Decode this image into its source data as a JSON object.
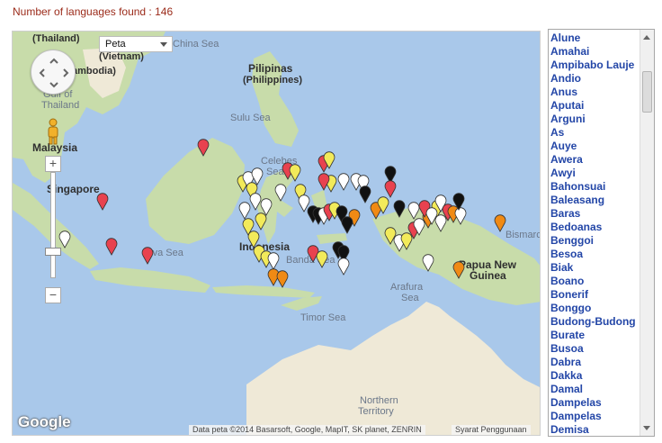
{
  "header": {
    "count_text": "Number of languages found : 146"
  },
  "map": {
    "type_select": "Peta",
    "labels": {
      "thailand": "(Thailand)",
      "vietnam": "(Vietnam)",
      "cambodia": "ambodia)",
      "gulf": "Gulf of",
      "thailand_gulf": "Thailand",
      "south_china_sea": "China Sea",
      "pilipinas": "Pilipinas",
      "philippines": "(Philippines)",
      "sulu_sea": "Sulu Sea",
      "celebes_sea": "Celebes",
      "celebes_sea2": "Sea",
      "malaysia": "Malaysia",
      "singapore": "Singapore",
      "indonesia": "Indonesia",
      "java_sea": "Java Sea",
      "banda_sea": "Banda Sea",
      "arafura_sea": "Arafura",
      "arafura_sea2": "Sea",
      "timor_sea": "Timor Sea",
      "papua": "Papua New",
      "guinea": "Guinea",
      "bismarck": "Bismarc",
      "northern": "Northern",
      "territory": "Territory"
    },
    "google": "Google",
    "attribution": "Data peta ©2014 Basarsoft, Google, MapIT, SK planet, ZENRIN",
    "terms": "Syarat Penggunaan",
    "colors": {
      "water": "#a9c8ea",
      "land": "#efe9d7",
      "green": "#c8dcaa",
      "red": "#e8424f",
      "yellow": "#f2ea5a",
      "orange": "#f08a14",
      "white": "#ffffff",
      "black": "#111111"
    }
  },
  "languages": [
    "Alune",
    "Amahai",
    "Ampibabo Lauje",
    "Andio",
    "Anus",
    "Aputai",
    "Arguni",
    "As",
    "Auye",
    "Awera",
    "Awyi",
    "Bahonsuai",
    "Baleasang",
    "Baras",
    "Bedoanas",
    "Benggoi",
    "Besoa",
    "Biak",
    "Boano",
    "Bonerif",
    "Bonggo",
    "Budong-Budong",
    "Burate",
    "Busoa",
    "Dabra",
    "Dakka",
    "Damal",
    "Dampelas",
    "Dampelas",
    "Demisa"
  ]
}
